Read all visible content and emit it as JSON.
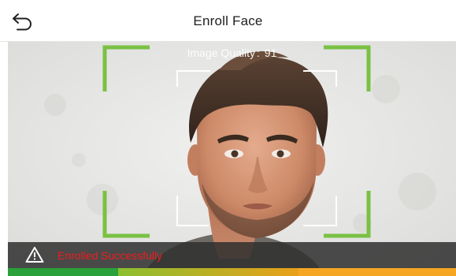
{
  "header": {
    "title": "Enroll Face",
    "back_icon": "back-arrow-icon"
  },
  "camera": {
    "quality_label": "Image Quality",
    "quality_separator": ":",
    "quality_value": "91",
    "frame_color": "#7ac143",
    "inner_frame_color": "#ffffff"
  },
  "status": {
    "icon": "warning-icon",
    "text": "Enrolled Successfully",
    "text_color": "#ee1c1c",
    "bar_color": "#303030"
  },
  "progress_strip": {
    "colors": [
      "#2aa13a",
      "#e8a019",
      "#f5a623"
    ]
  }
}
